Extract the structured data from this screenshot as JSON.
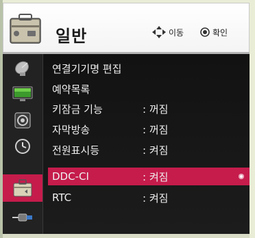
{
  "header": {
    "title": "일반",
    "move_hint": "이동",
    "confirm_hint": "확인",
    "icon": "toolbox-icon"
  },
  "sidebar": {
    "items": [
      {
        "name": "satellite-dish-icon",
        "active": false
      },
      {
        "name": "tv-screen-icon",
        "active": false
      },
      {
        "name": "speaker-icon",
        "active": false
      },
      {
        "name": "clock-icon",
        "active": false
      },
      {
        "name": "toolbox-icon",
        "active": true
      },
      {
        "name": "connector-cable-icon",
        "active": false
      }
    ]
  },
  "menu": {
    "items": [
      {
        "label": "연결기기명 편집",
        "value": ""
      },
      {
        "label": "예약목록",
        "value": ""
      },
      {
        "label": "키잠금 기능",
        "value": ": 꺼짐"
      },
      {
        "label": "자막방송",
        "value": ": 꺼짐"
      },
      {
        "label": "전원표시등",
        "value": ": 켜짐"
      },
      {
        "label": "DDC-CI",
        "value": ": 켜짐",
        "selected": true
      },
      {
        "label": "RTC",
        "value": ": 켜짐"
      }
    ]
  },
  "colors": {
    "accent": "#c51c4c",
    "menu_bg": "#161616",
    "header_bg": "#ffffff"
  }
}
